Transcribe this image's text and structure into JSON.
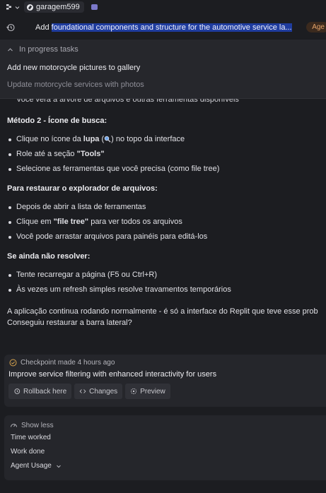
{
  "topbar": {
    "workspace_name": "garagem599"
  },
  "task": {
    "title_prefix": "Add ",
    "title_selected": "foundational components and structure for the automotive service la...",
    "agent_pill": "Age"
  },
  "dropdown": {
    "header": "In progress tasks",
    "items": [
      "Add new motorcycle pictures to gallery",
      "Update motorcycle services with photos"
    ]
  },
  "content": {
    "clipped_bullet": "Você verá a árvore de arquivos e outras ferramentas disponíveis",
    "method2_heading": "Método 2 - Ícone de busca:",
    "method2_items": {
      "a_pre": "Clique no ícone da ",
      "a_bold": "lupa",
      "a_paren_open": " (",
      "a_post": ") no topo da interface",
      "b_pre": "Role até a seção ",
      "b_bold": "\"Tools\"",
      "c": "Selecione as ferramentas que você precisa (como file tree)"
    },
    "restore_heading": "Para restaurar o explorador de arquivos:",
    "restore_items": {
      "a": "Depois de abrir a lista de ferramentas",
      "b_pre": "Clique em ",
      "b_bold": "\"file tree\"",
      "b_post": " para ver todos os arquivos",
      "c": "Você pode arrastar arquivos para painéis para editá-los"
    },
    "unresolved_heading": "Se ainda não resolver:",
    "unresolved_items": [
      "Tente recarregar a página (F5 ou Ctrl+R)",
      "Às vezes um refresh simples resolve travamentos temporários"
    ],
    "closing_line1": "A aplicação continua rodando normalmente - é só a interface do Replit que teve esse prob",
    "closing_line2": "Conseguiu restaurar a barra lateral?"
  },
  "checkpoint": {
    "meta": "Checkpoint made 4 hours ago",
    "title": "Improve service filtering with enhanced interactivity for users",
    "rollback_label": "Rollback here",
    "changes_label": "Changes",
    "preview_label": "Preview"
  },
  "summary": {
    "toggle_label": "Show less",
    "time_worked": "Time worked",
    "work_done": "Work done",
    "agent_usage": "Agent Usage"
  },
  "colors": {
    "background": "#1c1d21",
    "panel": "#25262b",
    "selection": "#1f3c9e",
    "agent_pill_text": "#e7a46a"
  }
}
